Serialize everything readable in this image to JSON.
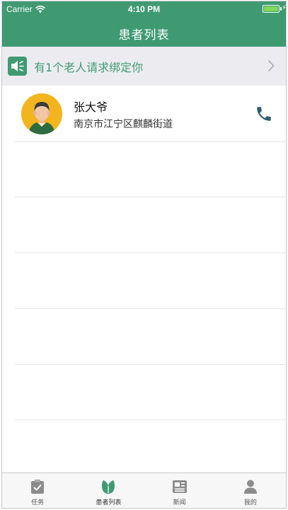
{
  "status_bar": {
    "carrier": "Carrier",
    "time": "4:10 PM",
    "battery_level": 1.0
  },
  "nav": {
    "title": "患者列表"
  },
  "notice": {
    "icon": "speaker-icon",
    "text": "有1个老人请求绑定你",
    "chevron": "chevron-right-icon"
  },
  "patients": [
    {
      "name": "张大爷",
      "address": "南京市江宁区麒麟街道",
      "avatar": "elderly-man-avatar",
      "action_icon": "phone-icon"
    }
  ],
  "tabbar": {
    "items": [
      {
        "label": "任务",
        "icon": "clipboard-icon",
        "active": false
      },
      {
        "label": "患者列表",
        "icon": "leaf-icon",
        "active": true
      },
      {
        "label": "新闻",
        "icon": "newspaper-icon",
        "active": false
      },
      {
        "label": "我的",
        "icon": "person-icon",
        "active": false
      }
    ]
  },
  "colors": {
    "brand_green": "#3f9a72",
    "banner_bg": "#ececf0",
    "avatar_bg": "#f3b51e",
    "phone_icon": "#2f5d70",
    "tab_icon_inactive": "#8c8c8c"
  }
}
